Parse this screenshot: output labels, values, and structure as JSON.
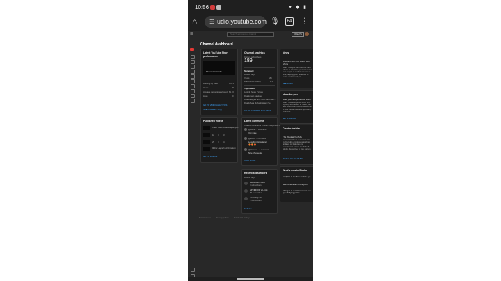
{
  "statusbar": {
    "time": "10:56",
    "right": "▾ ◆ ▮"
  },
  "browser": {
    "url": "udio.youtube.com",
    "tab_count": "64",
    "home_icon": "home-icon",
    "menu_icon": "more-vert-icon"
  },
  "topbar": {
    "search_placeholder": "Search across your channel",
    "create_label": "CREATE"
  },
  "dashboard": {
    "title": "Channel dashboard"
  },
  "short_perf": {
    "title": "Latest YouTube Short performance",
    "thumb_caption": "Sharabahi fatadu",
    "rows": [
      {
        "label": "Ranking by views",
        "value": "3 of 5"
      },
      {
        "label": "Views",
        "value": "40"
      },
      {
        "label": "Average percentage viewed",
        "value": "81.6%"
      },
      {
        "label": "Likes",
        "value": "0"
      }
    ],
    "link1": "GO TO VIDEO ANALYTICS",
    "link2": "SEE COMMENTS (0)"
  },
  "analytics": {
    "title": "Channel analytics",
    "subs_label": "Current subscribers",
    "subs_value": "189",
    "summary_title": "Summary",
    "summary_period": "Last 28 days",
    "summary_rows": [
      {
        "label": "Views",
        "value": "185"
      },
      {
        "label": "Watch time (hours)",
        "value": "1.1"
      }
    ],
    "top_title": "Top videos",
    "top_period": "Last 48 hours · Views",
    "top_rows": [
      "Dharkanein Aalekhe",
      "Dhakk aaj jaa raha hoon aasmaan...",
      "Dhakk Aaja Mohabbatpanti Se"
    ],
    "link": "GO TO CHANNEL ANALYTICS"
  },
  "published": {
    "title": "Published videos",
    "rows": [
      {
        "title": "Dhakk video dhakadhapaniyan",
        "v": "",
        "c": "",
        "l": ""
      },
      {
        "title": "",
        "v": "18",
        "c": "0",
        "l": "3"
      },
      {
        "title": "",
        "v": "29",
        "c": "0",
        "l": "4"
      },
      {
        "title": "Bilkhar Lagneh Hrishya kam",
        "v": "",
        "c": "",
        "l": ""
      }
    ],
    "link": "GO TO VIDEOS"
  },
  "comments": {
    "title": "Latest comments",
    "subtitle": "Channel comments I haven't responded to",
    "items": [
      {
        "name": "@Adhil · 1 comment",
        "text": "Very nice"
      },
      {
        "name": "@sultu · 1 comment",
        "text": "Love from Himalayan"
      },
      {
        "name": "@Yamuna · 1 comment",
        "text": "Nice bhegeenke"
      }
    ],
    "emoji": "😍😍😍",
    "link": "VIEW MORE"
  },
  "subscribers": {
    "title": "Recent subscribers",
    "subtitle": "Last 90 days",
    "items": [
      {
        "name": "SHAKUNA LORD",
        "sub": "0 subscribers"
      },
      {
        "name": "SPINHOOD VILLGE",
        "sub": "85 subscribers"
      },
      {
        "name": "Farrin Kaju Ki",
        "sub": "2 subscribers"
      }
    ],
    "link": "SEE ALL"
  },
  "news": {
    "title": "News",
    "text1": "Important help from videos with Shorts",
    "text2": "Learn how you can use YouTube Shorts to translate your videos for new people in a short amount of time, helping your audience to better understand you.",
    "link": "SEE MORE"
  },
  "ideas": {
    "title": "Ideas for you",
    "text1": "Make your next production video",
    "text2": "Learn how to improve MOD and Lighting techniques to make your next video look more professional to your viewers without spending a fortune.",
    "link": "GET STARTED"
  },
  "insider": {
    "title": "Creator Insider",
    "text1": "This Week at YouTube",
    "text2": "Creator Insider is a channel run by YouTube employees to share updates on features and experiments across YouTube & Studio. Subscribe to stay current.",
    "link": "WATCH ON YOUTUBE"
  },
  "whats_new": {
    "title": "What's new in Studio",
    "items": [
      "Analytics in YouTube mobile app",
      "New Content tab in Analytics",
      "Changes in our Harassment and cyberbullying policy"
    ]
  },
  "footer": {
    "terms": "Terms of use",
    "privacy": "Privacy policy",
    "policies": "Policies & Safety"
  }
}
